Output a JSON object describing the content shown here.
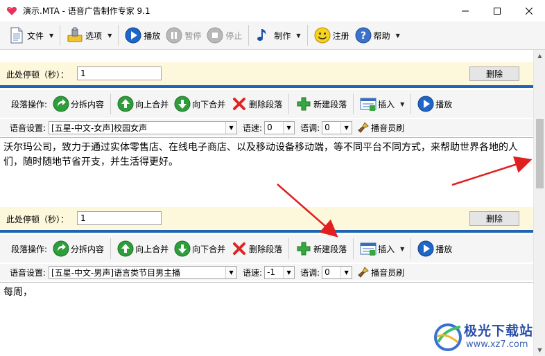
{
  "window": {
    "title": "演示.MTA - 语音广告制作专家 9.1"
  },
  "toolbar": {
    "file": "文件",
    "options": "选项",
    "play": "播放",
    "pause": "暂停",
    "stop": "停止",
    "make": "制作",
    "register": "注册",
    "help": "帮助"
  },
  "paragraph_toolbar": {
    "label": "段落操作:",
    "split": "分拆内容",
    "merge_up": "向上合并",
    "merge_down": "向下合并",
    "delete": "删除段落",
    "new": "新建段落",
    "insert": "插入",
    "play": "播放"
  },
  "labels": {
    "pause_label": "此处停顿（秒）：",
    "delete_button": "删除",
    "voice_setting": "语音设置:",
    "speed": "语速:",
    "pitch": "语调:",
    "announcer_brush": "播音员刷"
  },
  "paragraphs": [
    {
      "pause_value": "1",
      "voice": "[五星-中文-女声]校园女声",
      "speed": "0",
      "pitch": "0",
      "text": "沃尔玛公司，致力于通过实体零售店、在线电子商店、以及移动设备移动端，等不同平台不同方式，来帮助世界各地的人们，随时随地节省开支，并生活得更好。"
    },
    {
      "pause_value": "1",
      "voice": "[五星-中文-男声]语言类节目男主播",
      "speed": "-1",
      "pitch": "0",
      "text": "每周，"
    }
  ],
  "watermark": {
    "name": "极光下载站",
    "url": "www.xz7.com"
  },
  "colors": {
    "accent_blue": "#1e64b4",
    "pause_row_bg": "#fdf7dc",
    "arrow_red": "#e02020"
  }
}
